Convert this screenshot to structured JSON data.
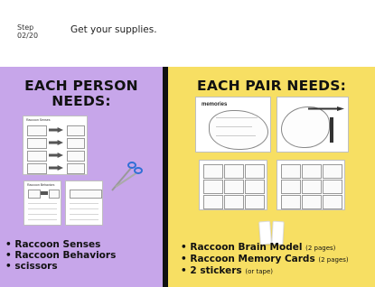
{
  "step": {
    "label": "Step",
    "count": "02/20",
    "title": "Get your supplies."
  },
  "left": {
    "heading_line1": "EACH PERSON",
    "heading_line2": "NEEDS:",
    "items": [
      "Raccoon Senses",
      "Raccoon Behaviors",
      "scissors"
    ],
    "sheet_senses_title": "Raccoon Senses",
    "sheet_behaviors_title": "Raccoon Behaviors"
  },
  "right": {
    "heading": "EACH PAIR NEEDS:",
    "items": [
      {
        "label": "Raccoon Brain Model",
        "note": "(2 pages)"
      },
      {
        "label": "Raccoon Memory Cards",
        "note": "(2 pages)"
      },
      {
        "label": "2 stickers",
        "note": "(or tape)"
      }
    ],
    "brain_label": "memories"
  },
  "colors": {
    "left_bg": "#c7a6ea",
    "right_bg": "#f7df63",
    "divider": "#111111",
    "scissors": "#2f6fd6"
  }
}
